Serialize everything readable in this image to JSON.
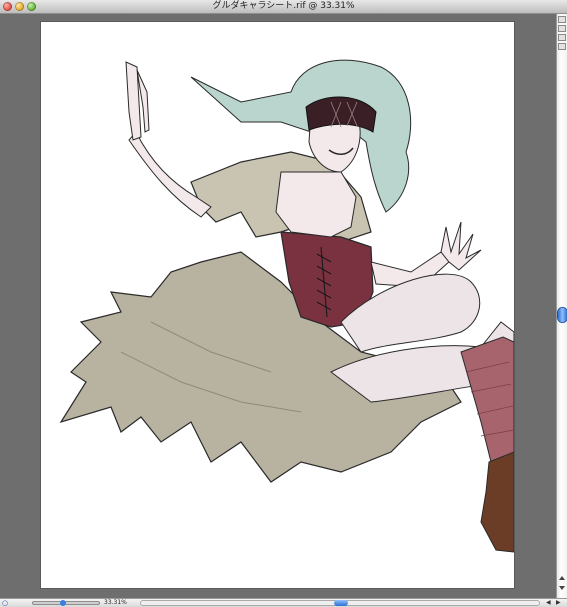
{
  "window": {
    "title": "グルダキャラシート.rif @ 33.31%"
  },
  "status": {
    "zoom_value": "33.31%",
    "zoom_level_percent": 33.31
  },
  "icons": {
    "close": "close-button",
    "minimize": "minimize-button",
    "zoom": "zoom-button",
    "zoom_tool": "magnifier-icon",
    "scroll_up": "arrow-up-icon",
    "scroll_down": "arrow-down-icon",
    "scroll_left": "arrow-left-icon",
    "scroll_right": "arrow-right-icon"
  },
  "colors": {
    "canvas_background": "#6e6e6e",
    "document_background": "#ffffff",
    "hair": "#b9d5cd",
    "dress": "#b8b2a0",
    "corset": "#7a3140",
    "stockings": "#a8646c",
    "boots": "#6b3d26",
    "blindfold": "#3a2026",
    "skin": "#f3e9ea"
  }
}
